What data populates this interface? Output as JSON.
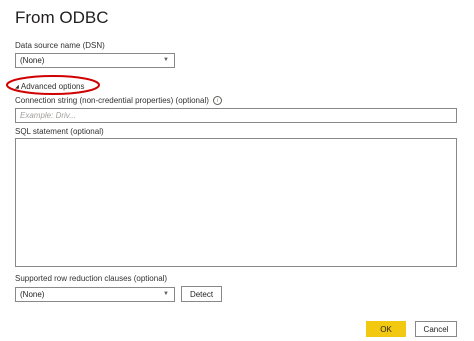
{
  "dialog": {
    "title": "From ODBC"
  },
  "dsn": {
    "label": "Data source name (DSN)",
    "value": "(None)"
  },
  "advanced": {
    "label": "Advanced options",
    "arrow": "◢"
  },
  "connection_string": {
    "label": "Connection string (non-credential properties) (optional)",
    "info_icon": "i",
    "placeholder": "Example: Driv..."
  },
  "sql": {
    "label": "SQL statement (optional)"
  },
  "row_reduction": {
    "label": "Supported row reduction clauses (optional)",
    "value": "(None)",
    "detect_label": "Detect"
  },
  "footer": {
    "ok_label": "OK",
    "cancel_label": "Cancel"
  },
  "colors": {
    "accent": "#f2c811",
    "annotation": "#d00000"
  }
}
